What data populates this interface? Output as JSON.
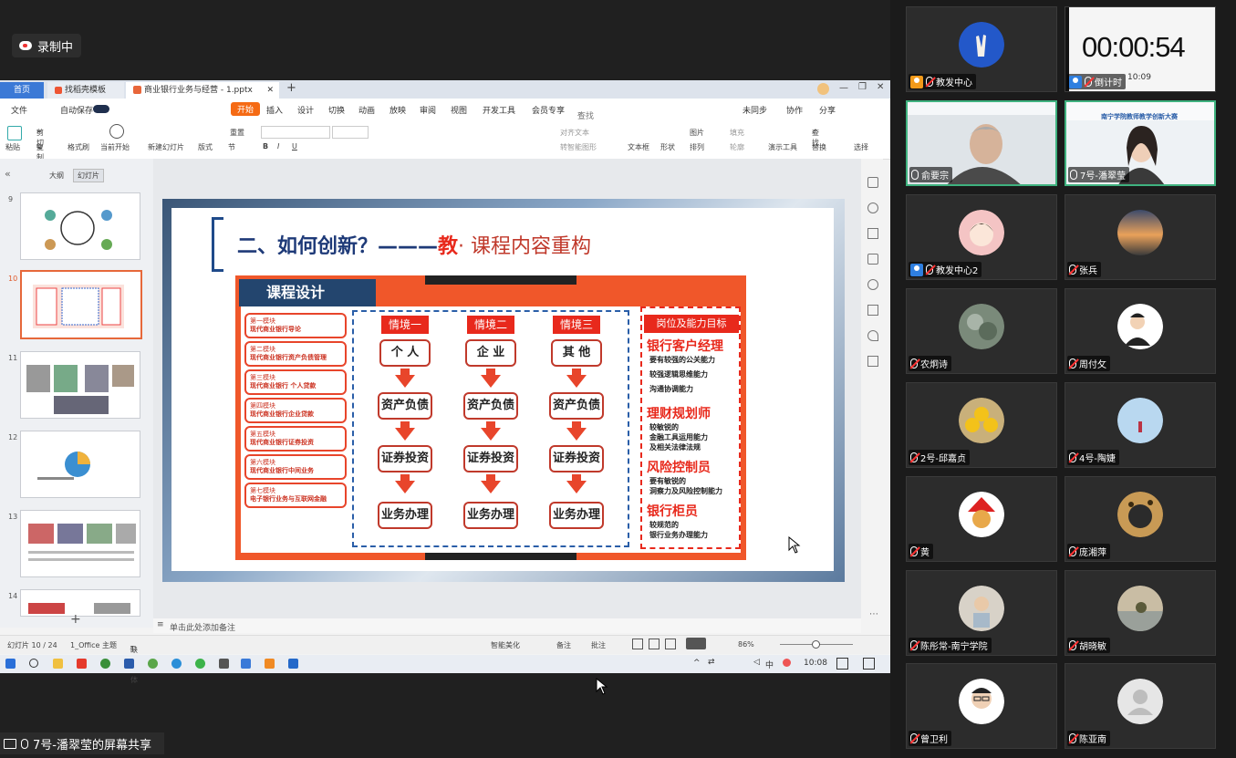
{
  "recording": {
    "label": "录制中"
  },
  "wps": {
    "tabs": {
      "home": "首页",
      "template": "找稻壳模板",
      "document": "商业银行业务与经营 - 1.pptx"
    },
    "menu": [
      "文件",
      "自动保存",
      "开始",
      "插入",
      "设计",
      "切换",
      "动画",
      "放映",
      "审阅",
      "视图",
      "开发工具",
      "会员专享",
      "查找命令、搜索模板"
    ],
    "menu_right": [
      "未同步",
      "协作",
      "分享"
    ],
    "ribbon": {
      "paste": "粘贴",
      "cut": "剪切",
      "copy": "复制",
      "format_painter": "格式刷",
      "play_from_current": "当前开始",
      "new_slide": "新建幻灯片",
      "layout": "版式",
      "section": "节",
      "reset": "重置",
      "text_box": "文本框",
      "shape": "形状",
      "arrange": "排列",
      "picture": "图片",
      "fill": "填充",
      "outline": "轮廓",
      "presentation_tools": "演示工具",
      "find": "查找",
      "replace": "替换",
      "select": "选择",
      "align_text": "对齐文本",
      "smart_graphic": "转智能图形"
    },
    "panel_tabs": {
      "outline": "大纲",
      "slides": "幻灯片"
    },
    "thumb_numbers": [
      "9",
      "10",
      "11",
      "12",
      "13",
      "14"
    ],
    "notes_placeholder": "单击此处添加备注",
    "status": {
      "slide": "幻灯片 10 / 24",
      "theme": "1_Office 主题",
      "missing_font": "缺失字体",
      "smart": "智能美化",
      "notes": "备注",
      "comment": "批注",
      "zoom": "86%"
    }
  },
  "slide": {
    "title_prefix": "二、如何创新？",
    "title_dash": "———",
    "title_highlight": "教",
    "title_suffix": "· 课程内容重构",
    "section_label": "课程设计",
    "modules": [
      {
        "a": "第一模块",
        "b": "现代商业银行导论"
      },
      {
        "a": "第二模块",
        "b": "现代商业银行资产负债管理"
      },
      {
        "a": "第三模块",
        "b": "现代商业银行 个人贷款"
      },
      {
        "a": "第四模块",
        "b": "现代商业银行企业贷款"
      },
      {
        "a": "第五模块",
        "b": "现代商业银行证券投资"
      },
      {
        "a": "第六模块",
        "b": "现代商业银行中间业务"
      },
      {
        "a": "第七模块",
        "b": "电子银行业务与互联网金融"
      }
    ],
    "scenarios": [
      {
        "header": "情境一",
        "steps": [
          "个 人",
          "资产负债",
          "证券投资",
          "业务办理"
        ]
      },
      {
        "header": "情境二",
        "steps": [
          "企 业",
          "资产负债",
          "证券投资",
          "业务办理"
        ]
      },
      {
        "header": "情境三",
        "steps": [
          "其 他",
          "资产负债",
          "证券投资",
          "业务办理"
        ]
      }
    ],
    "jobs_header": "岗位及能力目标",
    "jobs": [
      {
        "title": "银行客户经理",
        "lines": [
          "要有较强的公关能力",
          "较强逻辑思维能力",
          "沟通协调能力"
        ]
      },
      {
        "title": "理财规划师",
        "lines": [
          "较敏锐的",
          "金融工具运用能力",
          "及相关法律法规"
        ]
      },
      {
        "title": "风险控制员",
        "lines": [
          "要有敏锐的",
          "洞察力及风险控制能力"
        ]
      },
      {
        "title": "银行柜员",
        "lines": [
          "较规范的",
          "银行业务办理能力"
        ]
      }
    ]
  },
  "taskbar": {
    "time": "10:08",
    "ime": "中"
  },
  "share_label": "7号-潘翠莹的屏幕共享",
  "participants": [
    {
      "name": "教发中心",
      "kind": "peace"
    },
    {
      "name": "倒计时",
      "kind": "timer",
      "timer": "00:00:54",
      "clock": "10:09"
    },
    {
      "name": "俞要宗",
      "kind": "video-man"
    },
    {
      "name": "7号-潘翠莹",
      "kind": "video-woman",
      "banner": "南宁学院教师教学创新大赛"
    },
    {
      "name": "教发中心2",
      "kind": "cartoon"
    },
    {
      "name": "张兵",
      "kind": "sunset"
    },
    {
      "name": "农炯诗",
      "kind": "tree"
    },
    {
      "name": "周付攵",
      "kind": "suit"
    },
    {
      "name": "2号-邱嘉贞",
      "kind": "emoji"
    },
    {
      "name": "4号-陶婕",
      "kind": "sky"
    },
    {
      "name": "黄",
      "kind": "santa"
    },
    {
      "name": "庞湘萍",
      "kind": "leopard"
    },
    {
      "name": "陈彤常-南宁学院",
      "kind": "child"
    },
    {
      "name": "胡晓敏",
      "kind": "lake"
    },
    {
      "name": "曾卫利",
      "kind": "glasses"
    },
    {
      "name": "陈亚南",
      "kind": "default"
    }
  ]
}
